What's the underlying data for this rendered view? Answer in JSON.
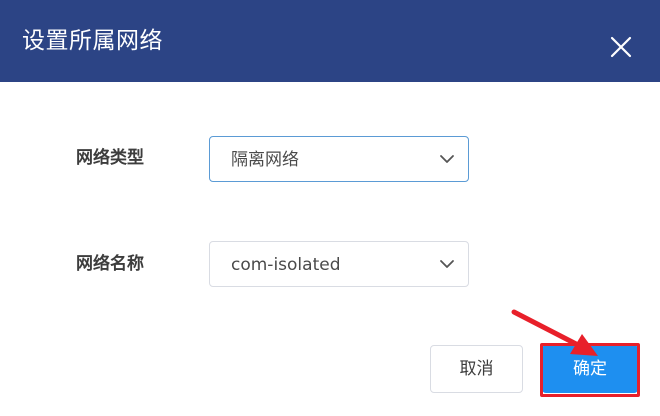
{
  "dialog": {
    "title": "设置所属网络",
    "close_icon": "close-icon"
  },
  "form": {
    "network_type": {
      "label": "网络类型",
      "value": "隔离网络",
      "icon": "chevron-down-icon"
    },
    "network_name": {
      "label": "网络名称",
      "value": "com-isolated",
      "icon": "chevron-down-icon"
    }
  },
  "footer": {
    "cancel_label": "取消",
    "confirm_label": "确定"
  },
  "colors": {
    "header_bg": "#2c4485",
    "primary": "#1e8ff0",
    "annotation": "#e8202a",
    "focus_border": "#5b9bd5"
  },
  "annotation": {
    "icon": "red-arrow-icon"
  }
}
